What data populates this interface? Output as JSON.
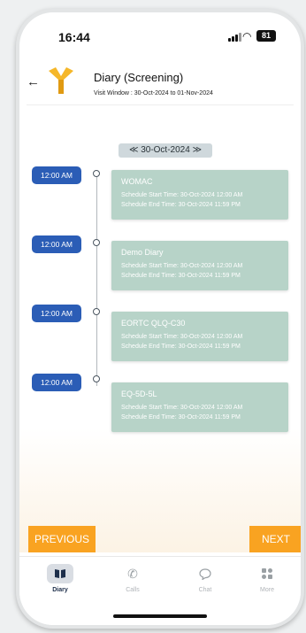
{
  "status": {
    "time": "16:44",
    "battery": "81"
  },
  "header": {
    "back_glyph": "←",
    "title": "Diary (Screening)",
    "visit_window": "Visit Window : 30-Oct-2024 to 01-Nov-2024"
  },
  "date_nav": {
    "prev_glyph": "≪",
    "date": "30-Oct-2024",
    "next_glyph": "≫"
  },
  "entries": [
    {
      "time": "12:00 AM",
      "name": "WOMAC",
      "start": "Schedule Start Time: 30-Oct-2024 12:00 AM",
      "end": "Schedule End Time: 30-Oct-2024 11:59 PM"
    },
    {
      "time": "12:00 AM",
      "name": "Demo Diary",
      "start": "Schedule Start Time: 30-Oct-2024 12:00 AM",
      "end": "Schedule End Time: 30-Oct-2024 11:59 PM"
    },
    {
      "time": "12:00 AM",
      "name": "EORTC QLQ-C30",
      "start": "Schedule Start Time: 30-Oct-2024 12:00 AM",
      "end": "Schedule End Time: 30-Oct-2024 11:59 PM"
    },
    {
      "time": "12:00 AM",
      "name": "EQ-5D-5L",
      "start": "Schedule Start Time: 30-Oct-2024 12:00 AM",
      "end": "Schedule End Time: 30-Oct-2024 11:59 PM"
    }
  ],
  "buttons": {
    "previous": "PREVIOUS",
    "next": "NEXT"
  },
  "tabs": [
    {
      "label": "Diary",
      "icon": "book-icon"
    },
    {
      "label": "Calls",
      "icon": "phone-icon"
    },
    {
      "label": "Chat",
      "icon": "chat-bubble-icon"
    },
    {
      "label": "More",
      "icon": "grid-icon"
    }
  ],
  "colors": {
    "accent": "#f9a321",
    "time_chip": "#2b5db6",
    "card": "#b7d3c8"
  }
}
